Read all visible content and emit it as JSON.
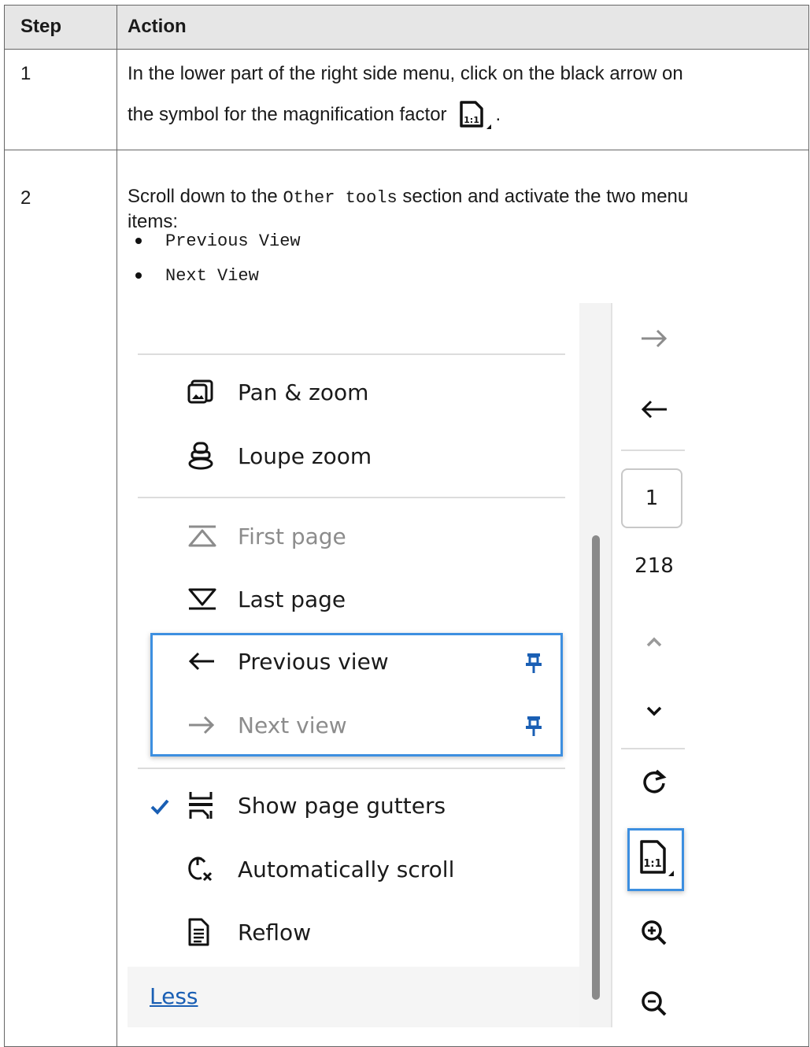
{
  "table": {
    "headers": {
      "step": "Step",
      "action": "Action"
    },
    "rows": [
      {
        "step": "1",
        "line1": "In the lower part of the right side menu, click on the black arrow on",
        "line2": "the symbol for the magnification factor",
        "line2_end": "."
      },
      {
        "step": "2",
        "line1_pre": "Scroll down to the",
        "line1_code": "Other tools",
        "line1_post": "section and activate the two menu",
        "line2": "items:",
        "bullets": [
          "Previous View",
          "Next View"
        ]
      }
    ]
  },
  "menu": {
    "items": [
      {
        "label": "Pan & zoom",
        "icon": "pan-zoom-icon",
        "state": "enabled"
      },
      {
        "label": "Loupe zoom",
        "icon": "loupe-zoom-icon",
        "state": "enabled"
      },
      {
        "label": "First page",
        "icon": "first-page-icon",
        "state": "disabled"
      },
      {
        "label": "Last page",
        "icon": "last-page-icon",
        "state": "enabled"
      },
      {
        "label": "Previous view",
        "icon": "arrow-left-icon",
        "state": "enabled",
        "pinned": true
      },
      {
        "label": "Next view",
        "icon": "arrow-right-icon",
        "state": "disabled",
        "pinned": true
      },
      {
        "label": "Show page gutters",
        "icon": "page-gutters-icon",
        "state": "enabled",
        "checked": true
      },
      {
        "label": "Automatically scroll",
        "icon": "auto-scroll-icon",
        "state": "enabled"
      },
      {
        "label": "Reflow",
        "icon": "reflow-icon",
        "state": "enabled"
      }
    ],
    "less_link": "Less"
  },
  "toolbar": {
    "page_current": "1",
    "page_total": "218",
    "icons": [
      "arrow-right-icon",
      "arrow-left-icon",
      "chevron-up-icon",
      "chevron-down-icon",
      "rotate-icon",
      "zoom-factor-icon",
      "zoom-in-icon",
      "zoom-out-icon"
    ]
  },
  "colors": {
    "highlight": "#3d8fe0",
    "link": "#1a5fb4",
    "disabled": "#8c8c8c",
    "header_bg": "#e6e6e6"
  }
}
